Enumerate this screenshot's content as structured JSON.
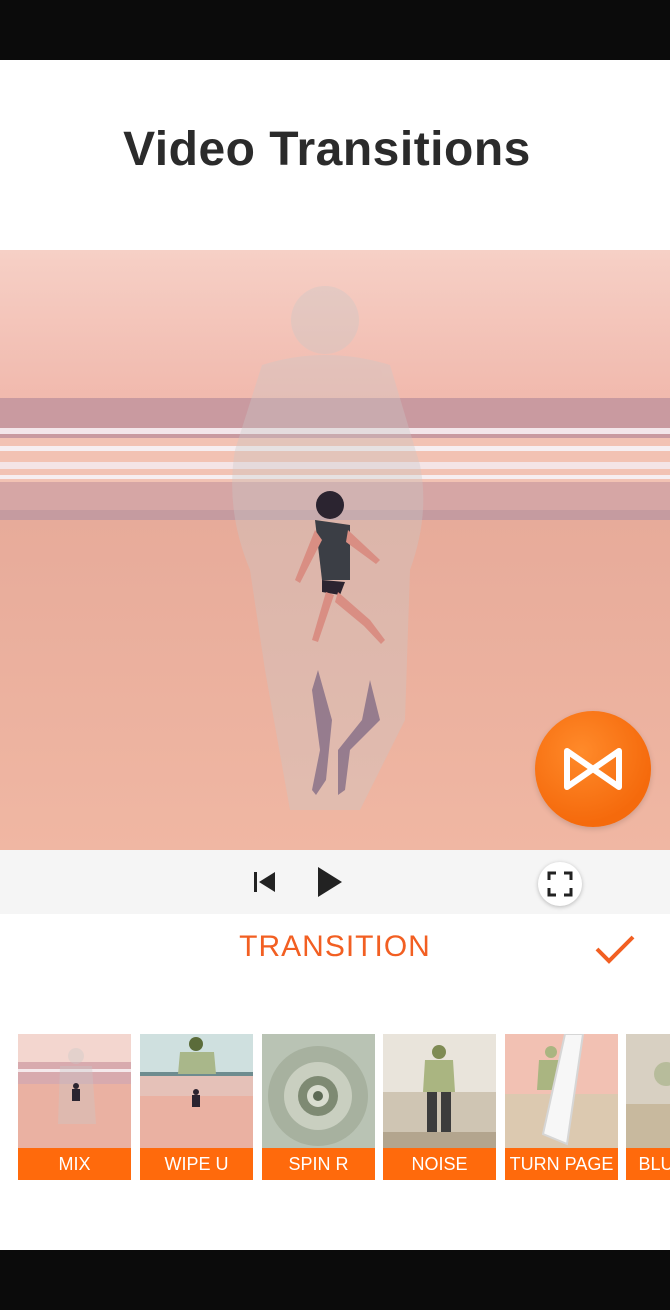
{
  "header": {
    "title": "Video Transitions"
  },
  "player": {
    "prev_icon": "skip-previous-icon",
    "play_icon": "play-icon",
    "fullscreen_icon": "fullscreen-icon",
    "fx_icon": "bowtie-transition-icon"
  },
  "toolbar": {
    "title": "TRANSITION",
    "confirm_icon": "checkmark-icon"
  },
  "transitions": [
    {
      "label": "MIX"
    },
    {
      "label": "WIPE U"
    },
    {
      "label": "SPIN R"
    },
    {
      "label": "NOISE"
    },
    {
      "label": "TURN PAGE"
    },
    {
      "label": "BLU"
    }
  ],
  "colors": {
    "accent": "#f25f22",
    "fx_button": "#f56a0c",
    "label_bg": "#ff6a0c"
  }
}
